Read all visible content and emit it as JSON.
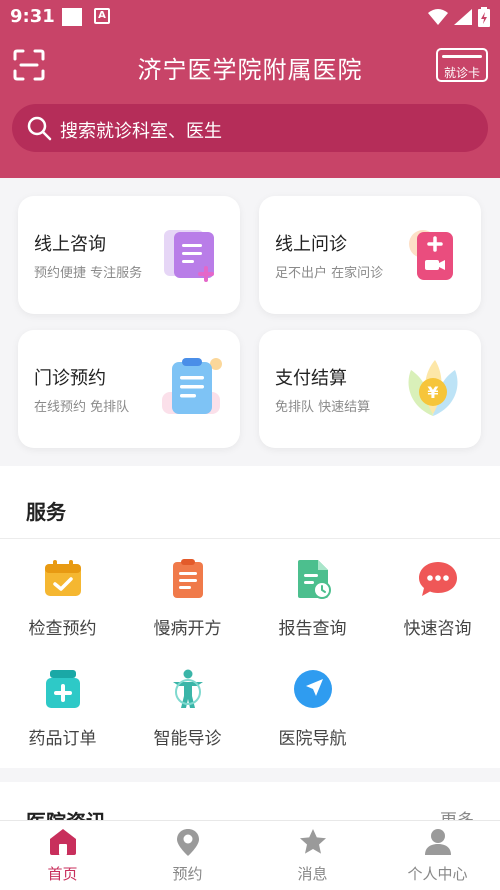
{
  "status_bar": {
    "time": "9:31"
  },
  "header": {
    "title": "济宁医学院附属医院",
    "card_button_label": "就诊卡",
    "search_placeholder": "搜索就诊科室、医生"
  },
  "quick_cards": [
    {
      "title": "线上咨询",
      "subtitle": "预约便捷  专注服务",
      "icon": "consult-doc-icon"
    },
    {
      "title": "线上问诊",
      "subtitle": "足不出户  在家问诊",
      "icon": "video-consult-icon"
    },
    {
      "title": "门诊预约",
      "subtitle": "在线预约  免排队",
      "icon": "clipboard-icon"
    },
    {
      "title": "支付结算",
      "subtitle": "免排队  快速结算",
      "icon": "yuan-coin-icon"
    }
  ],
  "services": {
    "title": "服务",
    "items": [
      {
        "label": "检查预约",
        "icon": "calendar-check-icon",
        "color": "#f5b731"
      },
      {
        "label": "慢病开方",
        "icon": "prescription-icon",
        "color": "#f07a4a"
      },
      {
        "label": "报告查询",
        "icon": "report-icon",
        "color": "#4cbf8e"
      },
      {
        "label": "快速咨询",
        "icon": "chat-bubble-icon",
        "color": "#ef5757"
      },
      {
        "label": "药品订单",
        "icon": "medicine-box-icon",
        "color": "#2ec9c7"
      },
      {
        "label": "智能导诊",
        "icon": "body-guide-icon",
        "color": "#3ab5a8"
      },
      {
        "label": "医院导航",
        "icon": "navigation-icon",
        "color": "#2f9cf0"
      }
    ]
  },
  "news": {
    "title": "医院资讯",
    "more": "更多"
  },
  "tabbar": {
    "items": [
      {
        "label": "首页",
        "icon": "home-icon",
        "active": true
      },
      {
        "label": "预约",
        "icon": "location-pin-icon",
        "active": false
      },
      {
        "label": "消息",
        "icon": "star-icon",
        "active": false
      },
      {
        "label": "个人中心",
        "icon": "person-icon",
        "active": false
      }
    ]
  },
  "colors": {
    "primary": "#c84468",
    "search_bg": "#b52d59",
    "active_tab": "#c82f5c"
  }
}
